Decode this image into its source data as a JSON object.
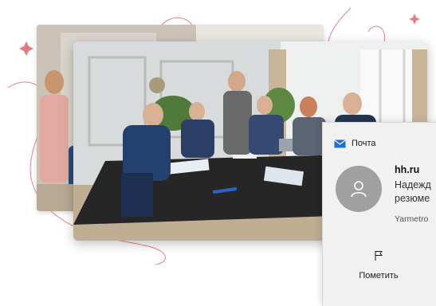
{
  "notification": {
    "app_name": "Почта",
    "sender": "hh.ru",
    "preview_line1": "Надежд",
    "preview_line2": "резюме",
    "account": "Yarmetro",
    "action_label": "Пометить"
  },
  "icons": {
    "app": "mail-icon",
    "avatar": "person-icon",
    "action": "flag-icon"
  },
  "colors": {
    "accent_blue": "#1e6fd0",
    "decor_red": "#e0606a",
    "toast_background": "#f1f1f1",
    "avatar_gray": "#a0a0a0"
  }
}
